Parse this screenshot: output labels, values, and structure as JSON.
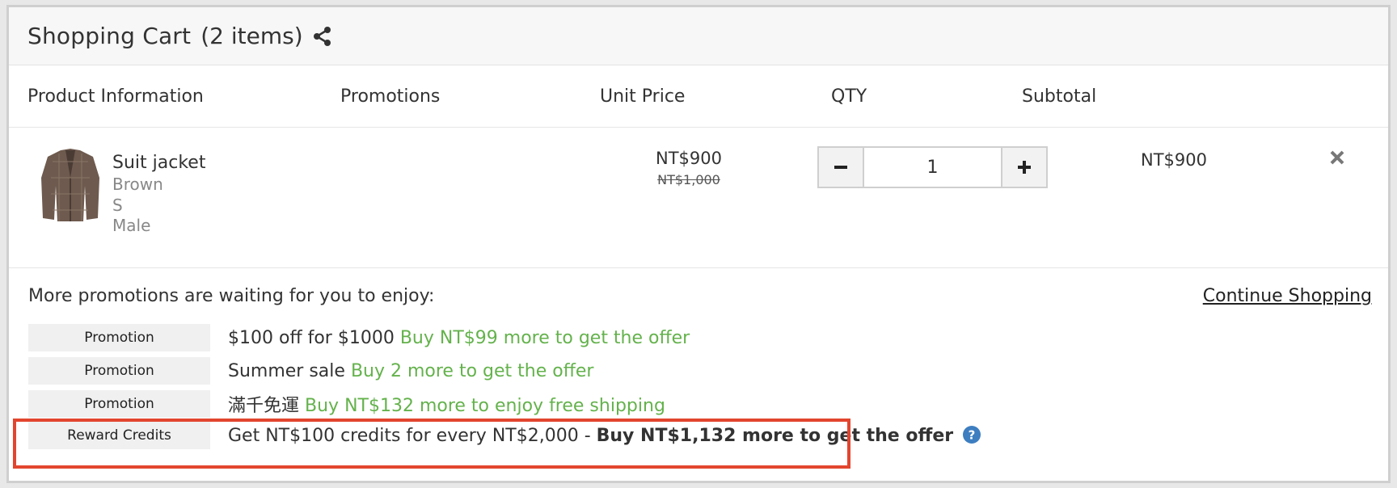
{
  "header": {
    "title": "Shopping Cart",
    "count": "(2 items)"
  },
  "columns": {
    "product": "Product Information",
    "promotions": "Promotions",
    "unit_price": "Unit Price",
    "qty": "QTY",
    "subtotal": "Subtotal"
  },
  "item": {
    "name": "Suit jacket",
    "color": "Brown",
    "size": "S",
    "gender": "Male",
    "price": "NT$900",
    "old_price": "NT$1,000",
    "quantity": "1",
    "subtotal": "NT$900"
  },
  "promotions": {
    "lead": "More promotions are waiting for you to enjoy:",
    "continue": "Continue Shopping",
    "rows": [
      {
        "tag": "Promotion",
        "text": "$100 off for $1000",
        "hint": "Buy NT$99 more to get the offer"
      },
      {
        "tag": "Promotion",
        "text": "Summer sale",
        "hint": "Buy 2 more to get the offer"
      },
      {
        "tag": "Promotion",
        "text": "滿千免運",
        "hint": "Buy NT$132 more to enjoy free shipping"
      }
    ],
    "reward": {
      "tag": "Reward Credits",
      "text": "Get NT$100 credits for every NT$2,000 - ",
      "bold": "Buy NT$1,132 more to get the offer"
    }
  },
  "colors": {
    "accent_green": "#64b24c",
    "highlight_red": "#e2452e",
    "help_blue": "#3d7ec0"
  },
  "icons": [
    "share-icon",
    "minus-icon",
    "plus-icon",
    "close-icon",
    "help-icon"
  ]
}
